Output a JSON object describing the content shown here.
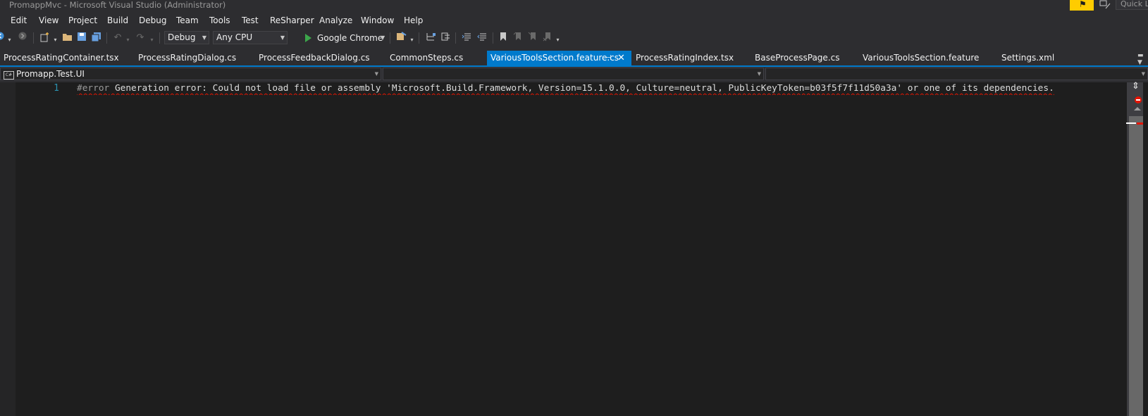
{
  "window": {
    "title": "PromappMvc - Microsoft Visual Studio  (Administrator)",
    "quick_launch_placeholder": "Quick L",
    "notification_glyph": "⚑"
  },
  "menu": [
    "Edit",
    "View",
    "Project",
    "Build",
    "Debug",
    "Team",
    "Tools",
    "Test",
    "ReSharper",
    "Analyze",
    "Window",
    "Help"
  ],
  "toolbar": {
    "configuration": "Debug",
    "platform": "Any CPU",
    "run_target": "Google Chrome"
  },
  "tabs": [
    {
      "label": "ProcessRatingContainer.tsx",
      "active": false
    },
    {
      "label": "ProcessRatingDialog.cs",
      "active": false
    },
    {
      "label": "ProcessFeedbackDialog.cs",
      "active": false
    },
    {
      "label": "CommonSteps.cs",
      "active": false
    },
    {
      "label": "VariousToolsSection.feature.cs",
      "active": true
    },
    {
      "label": "ProcessRatingIndex.tsx",
      "active": false
    },
    {
      "label": "BaseProcessPage.cs",
      "active": false
    },
    {
      "label": "VariousToolsSection.feature",
      "active": false
    },
    {
      "label": "Settings.xml",
      "active": false
    }
  ],
  "navigation": {
    "project": "Promapp.Test.UI",
    "project_icon_text": "C#",
    "type": "",
    "member": ""
  },
  "editor": {
    "line_number": "1",
    "directive": "#error",
    "code_text": " Generation error: Could not load file or assembly 'Microsoft.Build.Framework, Version=15.1.0.0, Culture=neutral, PublicKeyToken=b03f5f7f11d50a3a' or one of its dependencies."
  },
  "colors": {
    "accent": "#007acc",
    "background": "#2d2d30",
    "editor_background": "#1e1e1e",
    "error": "#e51400",
    "run_green": "#3ca64b",
    "notification_yellow": "#ffcc00",
    "line_number": "#2b91af"
  },
  "icons": {
    "back": "circle-arrow-left-icon",
    "forward": "circle-arrow-right-icon",
    "new_project": "new-project-icon",
    "open": "open-folder-icon",
    "save": "save-icon",
    "save_all": "save-all-icon",
    "undo": "undo-icon",
    "redo": "redo-icon",
    "run": "play-icon",
    "bookmark": "bookmark-icon"
  }
}
